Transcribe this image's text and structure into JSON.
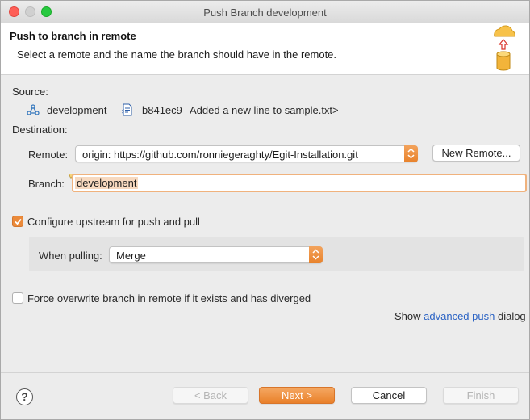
{
  "window": {
    "title": "Push Branch development"
  },
  "header": {
    "title": "Push to branch in remote",
    "description": "Select a remote and the name the branch should have in the remote."
  },
  "source": {
    "label": "Source:",
    "branch": "development",
    "commit_id": "b841ec9",
    "commit_message": "Added a new line to sample.txt>"
  },
  "destination": {
    "label": "Destination:",
    "remote_label": "Remote:",
    "remote_value": "origin: https://github.com/ronniegeraghty/Egit-Installation.git",
    "new_remote_button": "New Remote...",
    "branch_label": "Branch:",
    "branch_value": "development"
  },
  "upstream": {
    "checked": true,
    "label": "Configure upstream for push and pull",
    "when_pulling_label": "When pulling:",
    "when_pulling_value": "Merge"
  },
  "force": {
    "checked": false,
    "label": "Force overwrite branch in remote if it exists and has diverged"
  },
  "advanced": {
    "prefix": "Show",
    "link": "advanced push",
    "suffix": "dialog"
  },
  "footer": {
    "help": "?",
    "back": "< Back",
    "next": "Next >",
    "cancel": "Cancel",
    "finish": "Finish"
  },
  "colors": {
    "accent": "#e9802a",
    "link": "#2b63c4"
  }
}
